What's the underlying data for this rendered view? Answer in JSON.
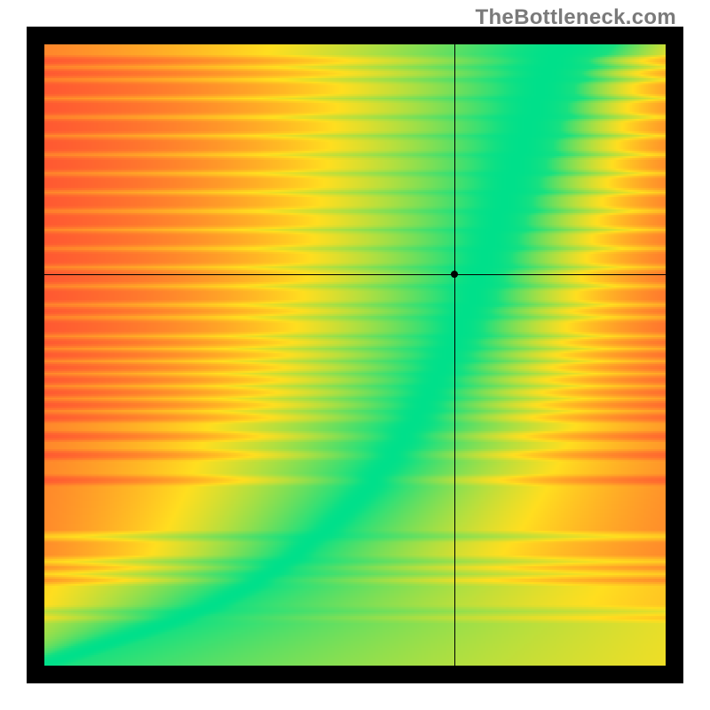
{
  "watermark": "TheBottleneck.com",
  "chart_data": {
    "type": "heatmap",
    "title": "",
    "xlabel": "",
    "ylabel": "",
    "axis_ranges": {
      "x": [
        0,
        100
      ],
      "y": [
        0,
        100
      ]
    },
    "grid": false,
    "legend_position": "none",
    "marker": {
      "x": 66,
      "y": 63
    },
    "colormap": {
      "name": "red-yellow-green-diverging",
      "stops": [
        {
          "t": 0.0,
          "hex": "#ff1a3a"
        },
        {
          "t": 0.5,
          "hex": "#ffde1f"
        },
        {
          "t": 1.0,
          "hex": "#00e08a"
        }
      ]
    },
    "ridge_curve_x_for_y": [
      0,
      3,
      6,
      9,
      12,
      15,
      18,
      21,
      23,
      26,
      28,
      30,
      32,
      34,
      35,
      37,
      38,
      40,
      41,
      42,
      43,
      45,
      46,
      47,
      48,
      49,
      50,
      51,
      52,
      53,
      53,
      54,
      55,
      56,
      56,
      57,
      58,
      58,
      59,
      60,
      60,
      61,
      61,
      62,
      62,
      63,
      63,
      64,
      64,
      65,
      65,
      66,
      66,
      67,
      67,
      67,
      68,
      68,
      69,
      69,
      69,
      70,
      70,
      70,
      71,
      71,
      71,
      72,
      72,
      72,
      73,
      73,
      73,
      74,
      74,
      74,
      75,
      75,
      75,
      76,
      76,
      76,
      77,
      77,
      77,
      78,
      78,
      78,
      79,
      79,
      79,
      80,
      80,
      80,
      81,
      81,
      82,
      82,
      83,
      84
    ],
    "description": "Heatmap on a 100×100 field. A narrow green ridge runs from the bottom-left corner diagonally up and to the right, steepening with height; regions left of the ridge fade through yellow-orange to red at the far left, and regions right of the ridge fade through yellow-orange to red toward the bottom-right corner. A black crosshair with a small dot marks a point at roughly (66, 63), which sits in the orange region to the right of the green ridge."
  },
  "accent_colors": {
    "frame": "#000000",
    "watermark": "#7a7a7a"
  }
}
